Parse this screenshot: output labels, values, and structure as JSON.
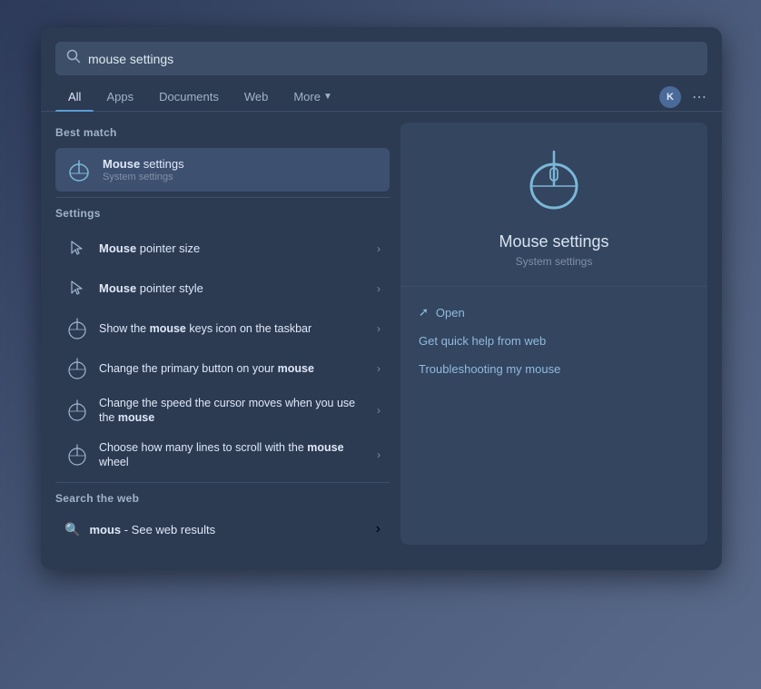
{
  "background": {
    "color": "#3a4a6b"
  },
  "search_bar": {
    "value": "mouse settings",
    "placeholder": "Search"
  },
  "nav_tabs": [
    {
      "label": "All",
      "active": true
    },
    {
      "label": "Apps",
      "active": false
    },
    {
      "label": "Documents",
      "active": false
    },
    {
      "label": "Web",
      "active": false
    },
    {
      "label": "More",
      "active": false
    }
  ],
  "nav_avatar_label": "K",
  "sections": {
    "best_match_label": "Best match",
    "settings_label": "Settings",
    "search_web_label": "Search the web"
  },
  "best_match": {
    "title_plain": "Mouse settings",
    "title_bold": "Mouse",
    "title_rest": " settings",
    "subtitle": "System settings"
  },
  "settings_items": [
    {
      "title_bold": "Mouse",
      "title_rest": " pointer size",
      "icon": "mouse-pointer"
    },
    {
      "title_bold": "Mouse",
      "title_rest": " pointer style",
      "icon": "mouse-pointer"
    },
    {
      "title_plain": "Show the ",
      "title_bold": "mouse",
      "title_rest": " keys icon on the taskbar",
      "icon": "mouse-icon"
    },
    {
      "title_plain": "Change the primary button on your ",
      "title_bold": "mouse",
      "title_rest": "",
      "icon": "mouse-icon"
    },
    {
      "title_plain": "Change the speed the cursor moves when you use the ",
      "title_bold": "mouse",
      "title_rest": "",
      "icon": "mouse-icon"
    },
    {
      "title_plain": "Choose how many lines to scroll with the ",
      "title_bold": "mouse",
      "title_rest": " wheel",
      "icon": "mouse-icon"
    }
  ],
  "web_search_item": {
    "text_plain": "mous",
    "text_rest": " - See web results"
  },
  "right_panel": {
    "title": "Mouse settings",
    "subtitle": "System settings",
    "open_label": "Open",
    "quick_help_label": "Get quick help from web",
    "troubleshooting_label": "Troubleshooting my mouse"
  }
}
